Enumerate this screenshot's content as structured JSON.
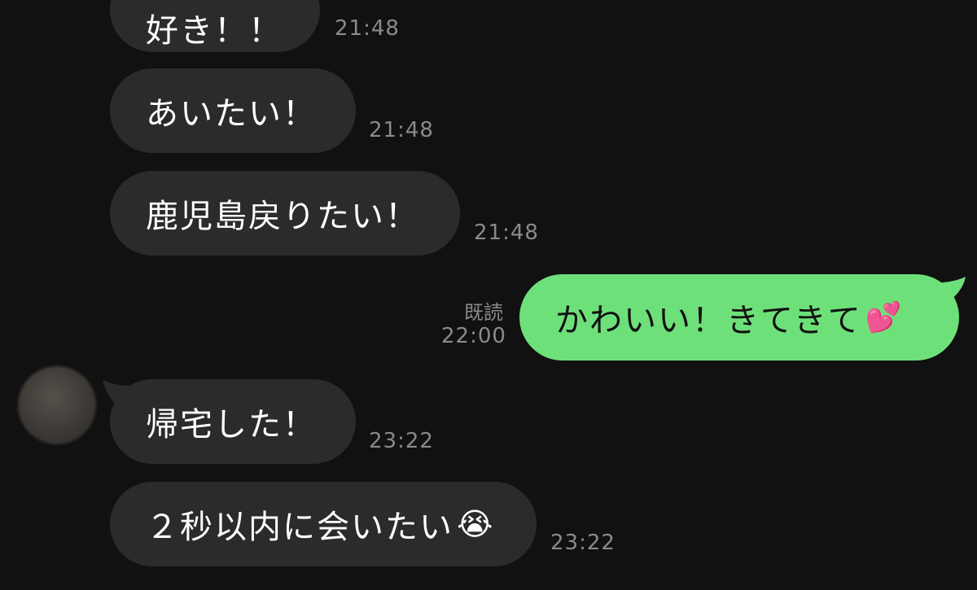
{
  "colors": {
    "background": "#111111",
    "incoming_bubble": "#2b2b2b",
    "outgoing_bubble": "#6ee07a",
    "timestamp": "#8a8a8a"
  },
  "messages": [
    {
      "direction": "incoming",
      "text": "好き！！",
      "time": "21:48"
    },
    {
      "direction": "incoming",
      "text": "あいたい！",
      "time": "21:48"
    },
    {
      "direction": "incoming",
      "text": "鹿児島戻りたい！",
      "time": "21:48"
    },
    {
      "direction": "outgoing",
      "text": "かわいい！きてきて",
      "emoji": "💕",
      "emoji_name": "two-hearts-icon",
      "read_label": "既読",
      "time": "22:00"
    },
    {
      "direction": "incoming",
      "text": "帰宅した！",
      "time": "23:22"
    },
    {
      "direction": "incoming",
      "text": "２秒以内に会いたい",
      "emoji": "😭",
      "emoji_name": "loudly-crying-face-icon",
      "time": "23:22"
    }
  ]
}
